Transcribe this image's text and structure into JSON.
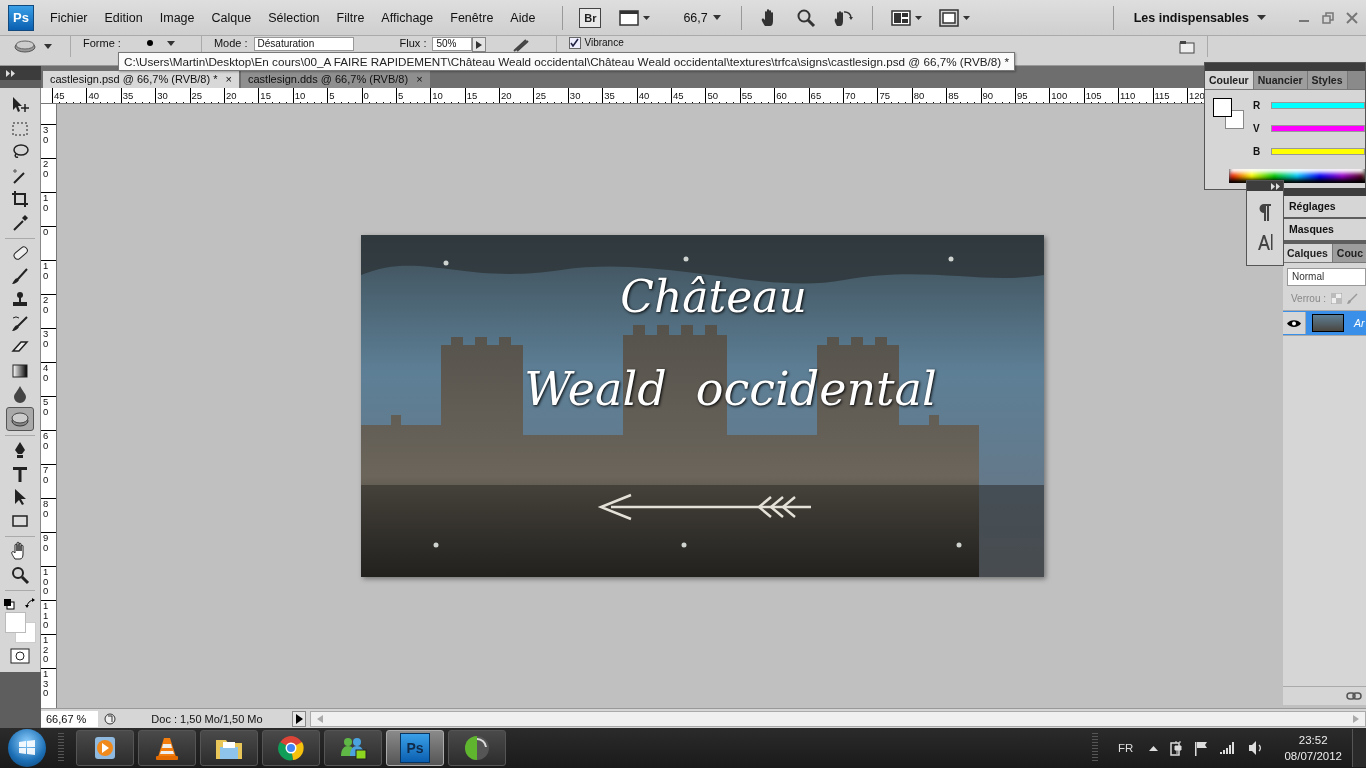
{
  "menubar": {
    "app_logo": "Ps",
    "menus": [
      "Fichier",
      "Edition",
      "Image",
      "Calque",
      "Sélection",
      "Filtre",
      "Affichage",
      "Fenêtre",
      "Aide"
    ],
    "bridge_button": "Br",
    "zoom": "66,7",
    "workspace": "Les indispensables"
  },
  "options_bar": {
    "shape_label": "Forme :",
    "mode_label": "Mode :",
    "mode_value": "Désaturation",
    "flow_label": "Flux :",
    "flow_value": "50%",
    "vibrance": {
      "label": "Vibrance",
      "checked": true
    }
  },
  "tooltip": "C:\\Users\\Martin\\Desktop\\En cours\\00_A FAIRE RAPIDEMENT\\Château Weald occidental\\Château Weald occidental\\textures\\trfca\\signs\\castlesign.psd @ 66,7% (RVB/8) *",
  "document_tabs": [
    {
      "label": "castlesign.psd @ 66,7% (RVB/8) *",
      "close": "×",
      "selected": true
    },
    {
      "label": "castlesign.dds @ 66,7% (RVB/8)",
      "close": "×",
      "selected": false
    }
  ],
  "tools": [
    {
      "kind": "move",
      "selected": false
    },
    {
      "kind": "marquee",
      "selected": false
    },
    {
      "kind": "lasso",
      "selected": false
    },
    {
      "kind": "wand",
      "selected": false
    },
    {
      "kind": "crop",
      "selected": false
    },
    {
      "kind": "eyedropper",
      "selected": false
    },
    {
      "kind": "healing",
      "selected": false
    },
    {
      "kind": "brush",
      "selected": false
    },
    {
      "kind": "stamp",
      "selected": false
    },
    {
      "kind": "history",
      "selected": false
    },
    {
      "kind": "eraser",
      "selected": false
    },
    {
      "kind": "gradient",
      "selected": false
    },
    {
      "kind": "blur",
      "selected": false
    },
    {
      "kind": "sponge",
      "selected": true
    },
    {
      "kind": "pen",
      "selected": false
    },
    {
      "kind": "type",
      "selected": false
    },
    {
      "kind": "path",
      "selected": false
    },
    {
      "kind": "shape",
      "selected": false
    },
    {
      "kind": "hand",
      "selected": false
    },
    {
      "kind": "zoom",
      "selected": false
    }
  ],
  "horizontal_ruler": [
    "45",
    "40",
    "35",
    "30",
    "25",
    "20",
    "15",
    "10",
    "5",
    "0",
    "5",
    "10",
    "15",
    "20",
    "25",
    "30",
    "35",
    "40",
    "45",
    "50",
    "55",
    "60",
    "65",
    "70",
    "75",
    "80",
    "85",
    "90",
    "95",
    "100",
    "105",
    "110",
    "115",
    "120"
  ],
  "vertical_ruler": [
    "30",
    "20",
    "10",
    "0",
    "10",
    "20",
    "30",
    "40",
    "50",
    "60",
    "70",
    "80",
    "90",
    "100",
    "110",
    "120",
    "130"
  ],
  "document": {
    "title_line": "Château",
    "subtitle_line": "Weald  occidental"
  },
  "color_panel": {
    "tabs": [
      {
        "label": "Couleur",
        "selected": true
      },
      {
        "label": "Nuancier",
        "selected": false
      },
      {
        "label": "Styles",
        "selected": false
      }
    ],
    "channels": [
      {
        "label": "R",
        "color": "#00ffff"
      },
      {
        "label": "V",
        "color": "#ff00ff"
      },
      {
        "label": "B",
        "color": "#ffff00"
      }
    ]
  },
  "collapsed_panels": [
    "Réglages",
    "Masques"
  ],
  "layers_panel": {
    "tabs": [
      {
        "label": "Calques",
        "selected": true
      },
      {
        "label": "Couc",
        "selected": false
      }
    ],
    "blend_mode": "Normal",
    "lock_label": "Verrou :",
    "layers": [
      {
        "name": "Ar",
        "visible": true,
        "selected": true
      }
    ]
  },
  "status_bar": {
    "zoom": "66,67 %",
    "doc_info": "Doc : 1,50 Mo/1,50 Mo"
  },
  "taskbar": {
    "apps": [
      {
        "kind": "media",
        "selected": false
      },
      {
        "kind": "cone",
        "selected": false
      },
      {
        "kind": "folder",
        "selected": false
      },
      {
        "kind": "browser",
        "selected": false
      },
      {
        "kind": "messenger",
        "selected": false
      },
      {
        "kind": "photoshop",
        "label": "Ps",
        "selected": true
      },
      {
        "kind": "disc",
        "selected": false
      }
    ],
    "language": "FR",
    "time": "23:52",
    "date": "08/07/2012"
  }
}
